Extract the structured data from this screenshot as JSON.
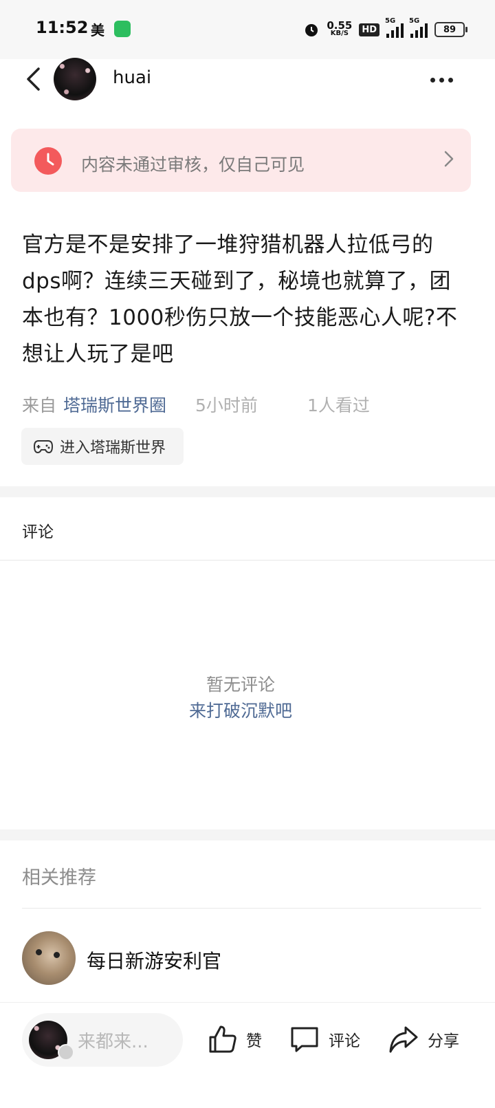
{
  "status_bar": {
    "time": "11:52",
    "carrier": "美",
    "net_speed": "0.55",
    "net_unit": "KB/S",
    "hd": "HD",
    "signal1": "5G",
    "signal2": "5G",
    "battery": "89"
  },
  "header": {
    "username": "huai"
  },
  "review_banner": {
    "text": "内容未通过审核，仅自己可见",
    "color": "#f35a5c"
  },
  "post": {
    "body": "官方是不是安排了一堆狩猎机器人拉低弓的dps啊？连续三天碰到了，秘境也就算了，团本也有？1000秒伤只放一个技能恶心人呢?不想让人玩了是吧",
    "from_label": "来自",
    "circle": "塔瑞斯世界圈",
    "time_ago": "5小时前",
    "views": "1人看过",
    "enter_button": "进入塔瑞斯世界"
  },
  "comments": {
    "title": "评论",
    "empty_text": "暂无评论",
    "empty_cta": "来打破沉默吧"
  },
  "recommend": {
    "title": "相关推荐",
    "items": [
      {
        "name": "每日新游安利官"
      }
    ]
  },
  "bottom_bar": {
    "input_placeholder": "来都来...",
    "like": "赞",
    "comment": "评论",
    "share": "分享"
  }
}
